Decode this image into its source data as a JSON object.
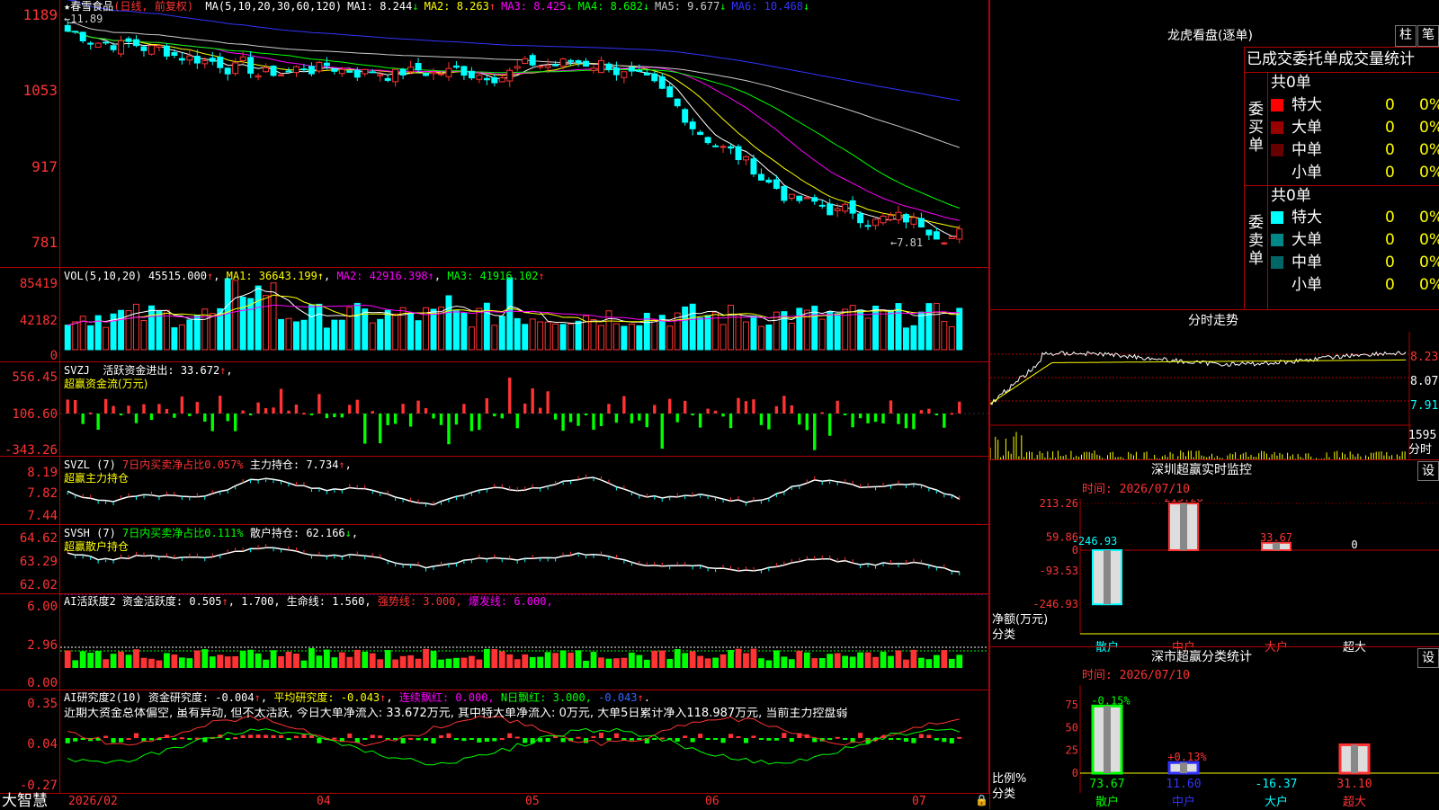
{
  "stock": {
    "name": "春雪食品",
    "period": "(日线, 前复权)",
    "ma": [
      {
        "label": "MA(5,10,20,30,60,120)",
        "value": "",
        "arrow": "",
        "color": "#ffffff"
      },
      {
        "label": "MA1:",
        "value": "8.244",
        "arrow": "↓",
        "color": "#ffffff"
      },
      {
        "label": "MA2:",
        "value": "8.263",
        "arrow": "↑",
        "color": "#ffff00"
      },
      {
        "label": "MA3:",
        "value": "8.425",
        "arrow": "↓",
        "color": "#ff00ff"
      },
      {
        "label": "MA4:",
        "value": "8.682",
        "arrow": "↓",
        "color": "#00ff00"
      },
      {
        "label": "MA5:",
        "value": "9.677",
        "arrow": "↓",
        "color": "#cccccc"
      },
      {
        "label": "MA6:",
        "value": "10.468",
        "arrow": "↓",
        "color": "#3333ff"
      }
    ],
    "high_label": "←11.89",
    "low_label": "←7.81",
    "price_axis": [
      "1189",
      "1053",
      "917",
      "781"
    ]
  },
  "vol": {
    "title": "VOL(5,10,20)",
    "value": "45515.000",
    "ma1": "36643.199",
    "ma2": "42916.398",
    "ma3": "41916.102",
    "axis": [
      "85419",
      "42182",
      "0"
    ]
  },
  "svzj": {
    "title": "SVZJ",
    "desc": "活跃资金进出:",
    "value": "33.672",
    "sub": "超赢资金流(万元)",
    "axis": [
      "556.45",
      "106.60",
      "-343.26"
    ]
  },
  "svzl": {
    "title": "SVZL (7)",
    "desc": "7日内买卖净占比0.057%",
    "label": "主力持仓:",
    "value": "7.734",
    "sub": "超赢主力持仓",
    "axis": [
      "8.19",
      "7.82",
      "7.44"
    ]
  },
  "svsh": {
    "title": "SVSH (7)",
    "desc": "7日内买卖净占比0.111%",
    "label": "散户持仓:",
    "value": "62.166",
    "sub": "超赢散户持仓",
    "axis": [
      "64.62",
      "63.29",
      "62.02"
    ]
  },
  "ai1": {
    "title": "AI活跃度2",
    "label": "资金活跃度:",
    "value": "0.505",
    "v2": "1.700",
    "life": "生命线: 1.560,",
    "strong": "强势线: 3.000,",
    "burst": "爆发线: 6.000,",
    "axis": [
      "6.00",
      "2.96",
      "0.00"
    ]
  },
  "ai2": {
    "title": "AI研究度2(10)",
    "label": "资金研究度:",
    "value": "-0.004",
    "avg_label": "平均研究度:",
    "avg": "-0.043",
    "red_label": "连续飘红:",
    "red": "0.000,",
    "nred_label": "N日飘红:",
    "nred": "3.000,",
    "last": "-0.043",
    "comment": "近期大资金总体偏空, 虽有异动, 但不太活跃, 今日大单净流入: 33.672万元, 其中特大单净流入: 0万元, 大单5日累计净入118.987万元, 当前主力控盘弱",
    "axis": [
      "0.35",
      "0.04",
      "-0.27"
    ]
  },
  "date_axis": [
    "2026/02",
    "04",
    "05",
    "06",
    "07"
  ],
  "brand": "大智慧",
  "right": {
    "lhb_title": "龙虎看盘(逐单)",
    "btn_zhu": "柱",
    "btn_bi": "笔",
    "tabs_header": "已成交委托单成交量统计",
    "buy_side": "委买单",
    "sell_side": "委卖单",
    "buy_total": "共0单",
    "sell_total": "共0单",
    "buy_rows": [
      {
        "label": "特大",
        "count": "0",
        "pct": "0%",
        "color": "#ff0000"
      },
      {
        "label": "大单",
        "count": "0",
        "pct": "0%",
        "color": "#990000"
      },
      {
        "label": "中单",
        "count": "0",
        "pct": "0%",
        "color": "#660000"
      },
      {
        "label": "小单",
        "count": "0",
        "pct": "0%",
        "color": ""
      }
    ],
    "sell_rows": [
      {
        "label": "特大",
        "count": "0",
        "pct": "0%",
        "color": "#00ffff"
      },
      {
        "label": "大单",
        "count": "0",
        "pct": "0%",
        "color": "#008888"
      },
      {
        "label": "中单",
        "count": "0",
        "pct": "0%",
        "color": "#006666"
      },
      {
        "label": "小单",
        "count": "0",
        "pct": "0%",
        "color": ""
      }
    ],
    "intraday_title": "分时走势",
    "intraday_axis": [
      "8.23",
      "8.07",
      "7.91"
    ],
    "intraday_vol": "1595",
    "intraday_vol_label": "分时",
    "sz_title": "深圳超赢实时监控",
    "sz_btn": "设",
    "sz_time": "时间: 2026/07/10",
    "sz_axis": [
      "213.26",
      "59.86",
      "0",
      "-93.53",
      "-246.93"
    ],
    "sz_bars": [
      {
        "cat": "散户",
        "value": -246.93,
        "label": "-246.93"
      },
      {
        "cat": "中户",
        "value": 213.26,
        "label": "213.26"
      },
      {
        "cat": "大户",
        "value": 33.67,
        "label": "33.67"
      },
      {
        "cat": "超大",
        "value": 0,
        "label": "0"
      }
    ],
    "sz_ylabel": "净额(万元)",
    "sz_xlabel": "分类",
    "cls_title": "深市超赢分类统计",
    "cls_btn": "设",
    "cls_time": "时间: 2026/07/10",
    "cls_axis": [
      "75",
      "50",
      "25",
      "0"
    ],
    "cls_bars": [
      {
        "cat": "散户",
        "value": 73.67,
        "label": "73.67",
        "delta": "-0.15%",
        "color": "green"
      },
      {
        "cat": "中户",
        "value": 11.6,
        "label": "11.60",
        "delta": "+0.13%",
        "color": "blue"
      },
      {
        "cat": "大户",
        "value": -16.37,
        "label": "-16.37",
        "delta": "",
        "color": "none"
      },
      {
        "cat": "超大",
        "value": 31.1,
        "label": "31.10",
        "delta": "",
        "color": "red"
      }
    ],
    "cls_ylabel": "比例%",
    "cls_xlabel": "分类"
  }
}
